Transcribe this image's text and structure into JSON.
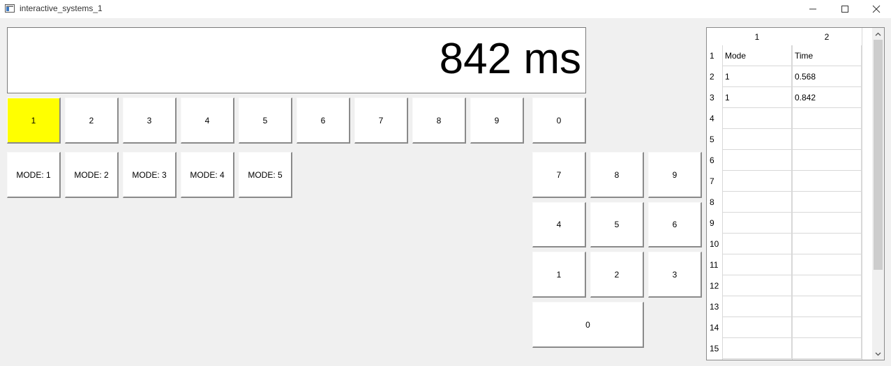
{
  "window": {
    "title": "interactive_systems_1",
    "icon": "app-window-icon",
    "controls": [
      "minimize-icon",
      "maximize-icon",
      "close-icon"
    ]
  },
  "display": {
    "text": "842 ms"
  },
  "target_keys": {
    "labels": [
      "1",
      "2",
      "3",
      "4",
      "5",
      "6",
      "7",
      "8",
      "9",
      "0"
    ],
    "active_index": 0,
    "active_color": "#ffff00"
  },
  "mode_buttons": [
    "MODE: 1",
    "MODE: 2",
    "MODE: 3",
    "MODE: 4",
    "MODE: 5"
  ],
  "numpad": {
    "rows": [
      [
        "7",
        "8",
        "9"
      ],
      [
        "4",
        "5",
        "6"
      ],
      [
        "1",
        "2",
        "3"
      ]
    ],
    "zero": "0"
  },
  "table": {
    "column_headers": [
      "1",
      "2"
    ],
    "row_numbers": [
      "1",
      "2",
      "3",
      "4",
      "5",
      "6",
      "7",
      "8",
      "9",
      "10",
      "11",
      "12",
      "13",
      "14",
      "15"
    ],
    "rows": [
      [
        "Mode",
        "Time"
      ],
      [
        "1",
        "0.568"
      ],
      [
        "1",
        "0.842"
      ],
      [
        "",
        ""
      ],
      [
        "",
        ""
      ],
      [
        "",
        ""
      ],
      [
        "",
        ""
      ],
      [
        "",
        ""
      ],
      [
        "",
        ""
      ],
      [
        "",
        ""
      ],
      [
        "",
        ""
      ],
      [
        "",
        ""
      ],
      [
        "",
        ""
      ],
      [
        "",
        ""
      ],
      [
        "",
        ""
      ]
    ],
    "scroll_icons": [
      "chevron-up-icon",
      "chevron-down-icon"
    ]
  }
}
